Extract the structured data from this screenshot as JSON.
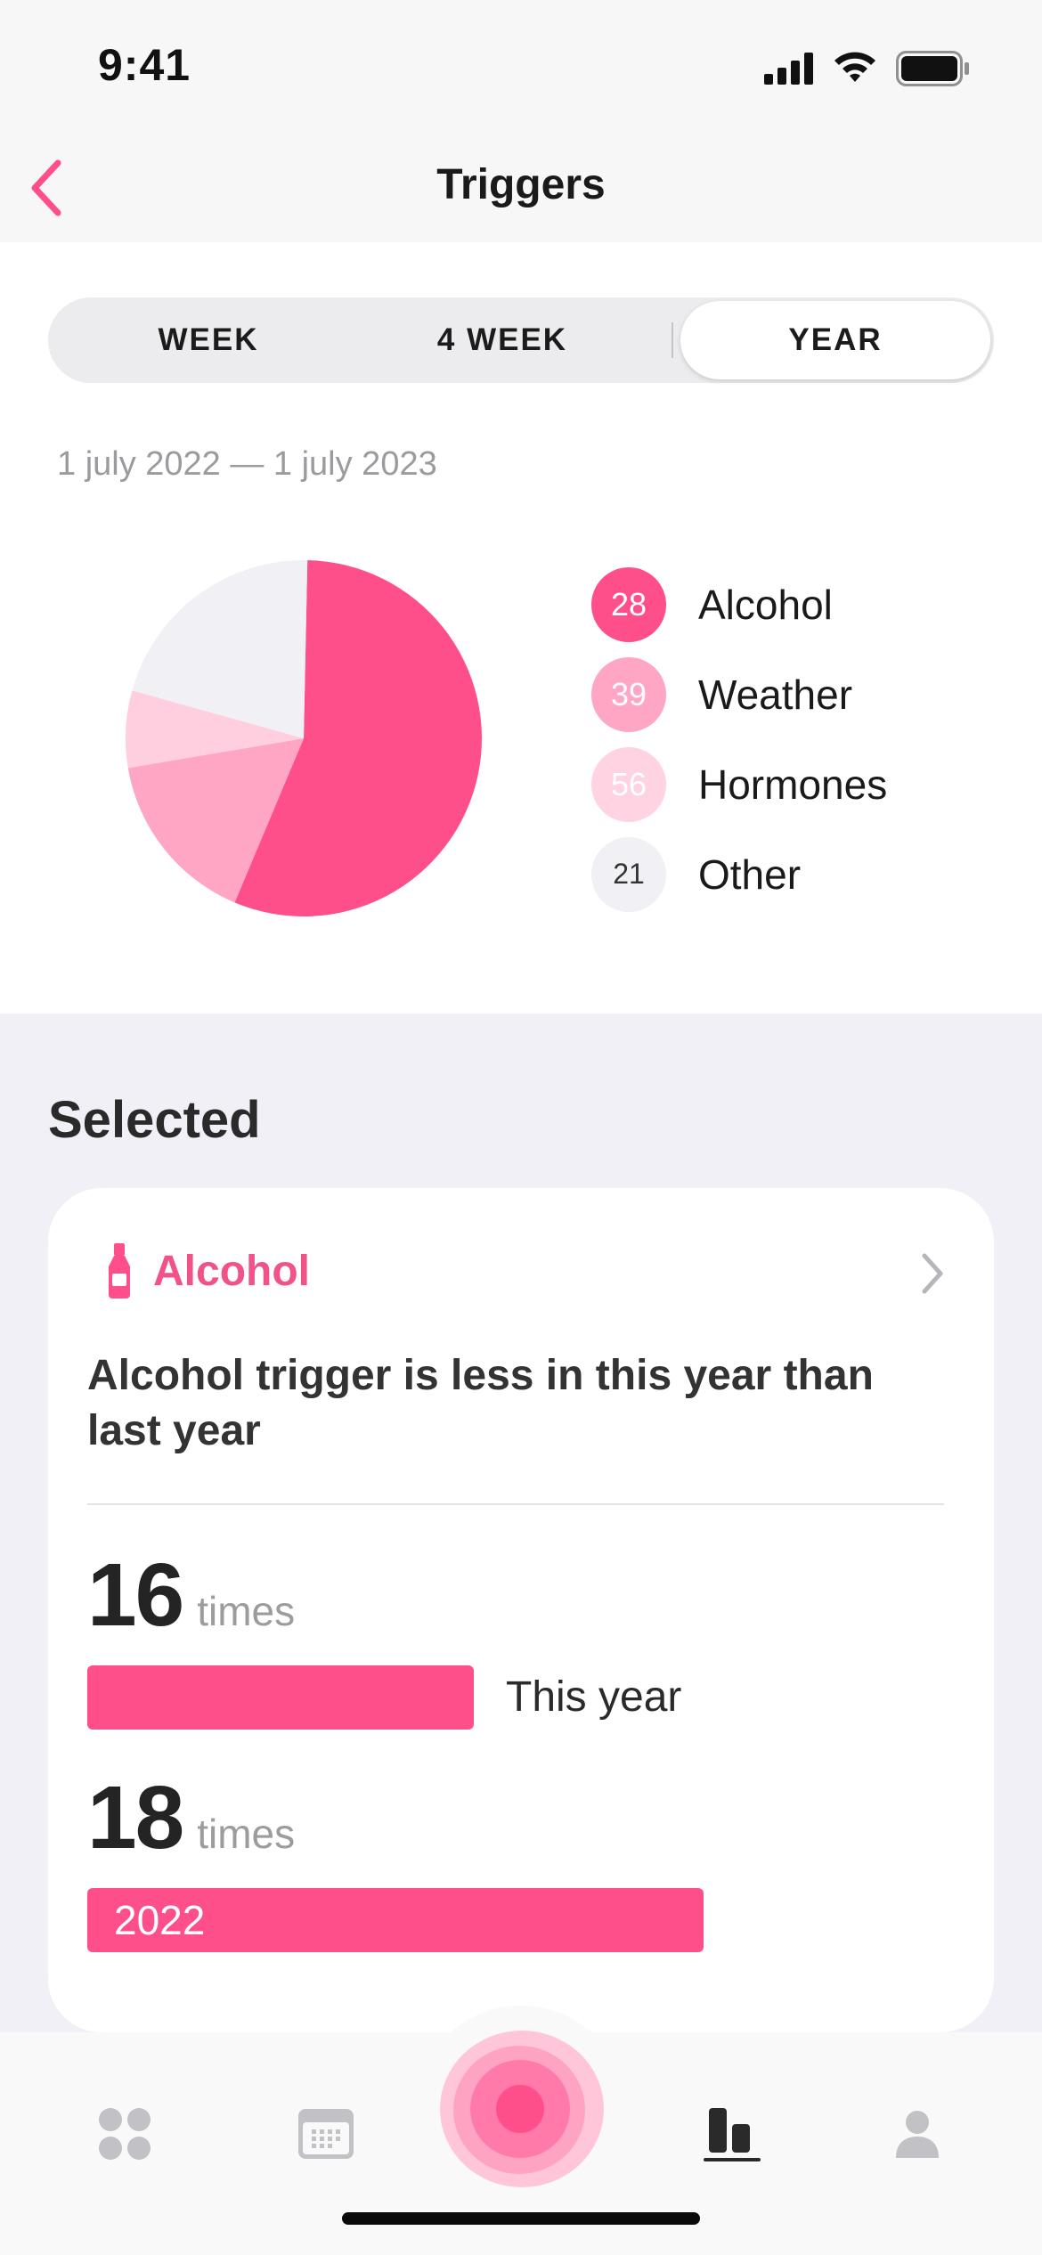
{
  "status_bar": {
    "time": "9:41"
  },
  "nav": {
    "title": "Triggers"
  },
  "segments": {
    "week": "WEEK",
    "four_week": "4 WEEK",
    "year": "YEAR",
    "selected": "YEAR"
  },
  "date_range": "1 july 2022 — 1 july 2023",
  "chart_data": {
    "type": "pie",
    "slices": [
      {
        "label": "Alcohol",
        "value": 56,
        "color": "#ff4f8b"
      },
      {
        "label": "Weather",
        "value": 16,
        "color": "#ffa6c4"
      },
      {
        "label": "Hormones",
        "value": 7,
        "color": "#ffcfdf"
      },
      {
        "label": "Other",
        "value": 21,
        "color": "#f0f0f5"
      }
    ]
  },
  "legend": [
    {
      "count": "28",
      "label": "Alcohol",
      "color": "#ff4f8b",
      "text_color": "#ffffff"
    },
    {
      "count": "39",
      "label": "Weather",
      "color": "#ffa6c4",
      "text_color": "#ffffff"
    },
    {
      "count": "56",
      "label": "Hormones",
      "color": "#ffd3e2",
      "text_color": "#ffffff"
    },
    {
      "count": "21",
      "label": "Other",
      "color": "#f0f0f5",
      "text_color": "#333333"
    }
  ],
  "selected": {
    "section_title": "Selected",
    "trigger_name": "Alcohol",
    "icon": "bottle-icon",
    "description": "Alcohol  trigger is less in this year than last year",
    "current": {
      "count": "16",
      "unit": "times",
      "label": "This year",
      "value": 16
    },
    "previous": {
      "count": "18",
      "unit": "times",
      "label": "2022",
      "value": 18
    }
  },
  "tab_bar": {
    "items": [
      "dashboard-icon",
      "calendar-icon",
      "record-icon",
      "stats-icon",
      "profile-icon"
    ],
    "active": "stats-icon"
  },
  "colors": {
    "accent": "#ff4f8b",
    "accent_text": "#f0528a"
  }
}
